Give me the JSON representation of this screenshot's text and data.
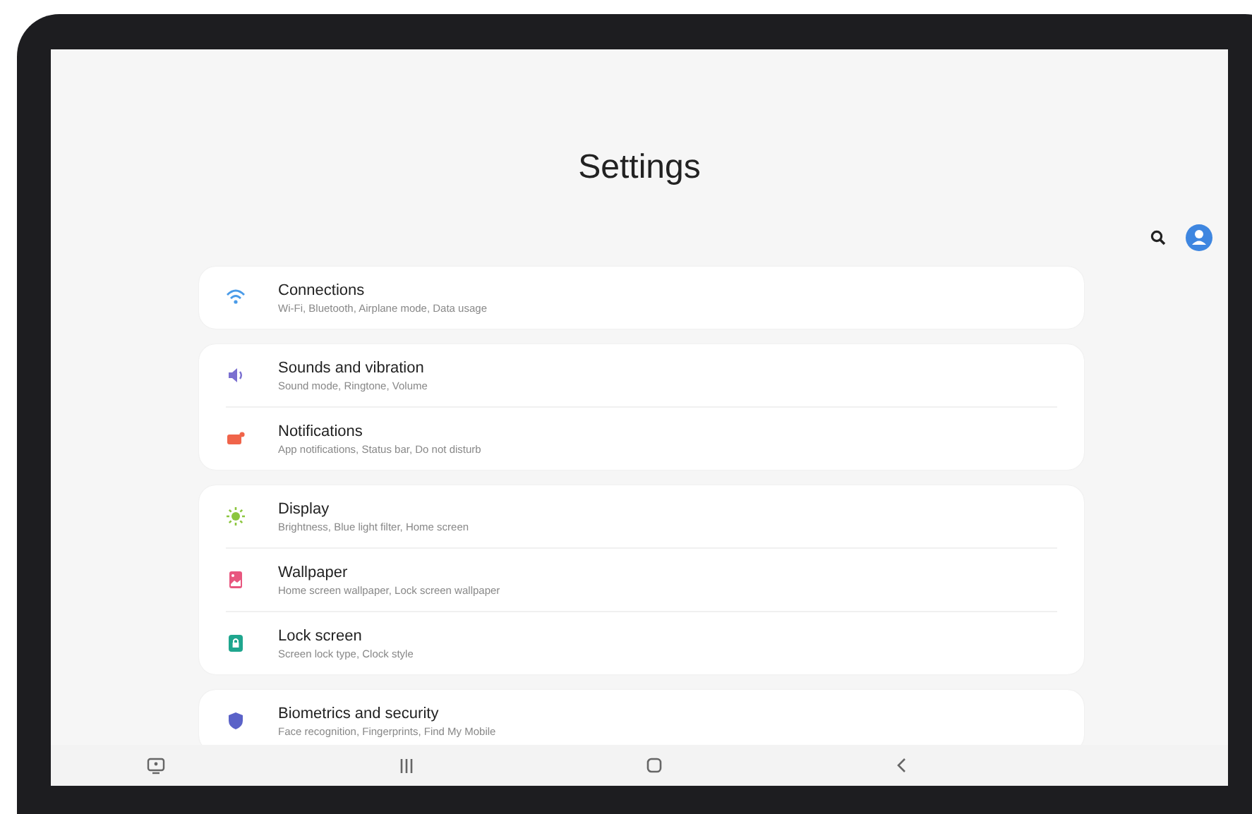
{
  "screen": {
    "title": "Settings"
  },
  "groups": [
    {
      "items": [
        {
          "title": "Connections",
          "subtitle": "Wi-Fi, Bluetooth, Airplane mode, Data usage"
        }
      ]
    },
    {
      "items": [
        {
          "title": "Sounds and vibration",
          "subtitle": "Sound mode, Ringtone, Volume"
        },
        {
          "title": "Notifications",
          "subtitle": "App notifications, Status bar, Do not disturb"
        }
      ]
    },
    {
      "items": [
        {
          "title": "Display",
          "subtitle": "Brightness, Blue light filter, Home screen"
        },
        {
          "title": "Wallpaper",
          "subtitle": "Home screen wallpaper, Lock screen wallpaper"
        },
        {
          "title": "Lock screen",
          "subtitle": "Screen lock type, Clock style"
        }
      ]
    },
    {
      "items": [
        {
          "title": "Biometrics and security",
          "subtitle": "Face recognition, Fingerprints, Find My Mobile"
        }
      ]
    }
  ]
}
